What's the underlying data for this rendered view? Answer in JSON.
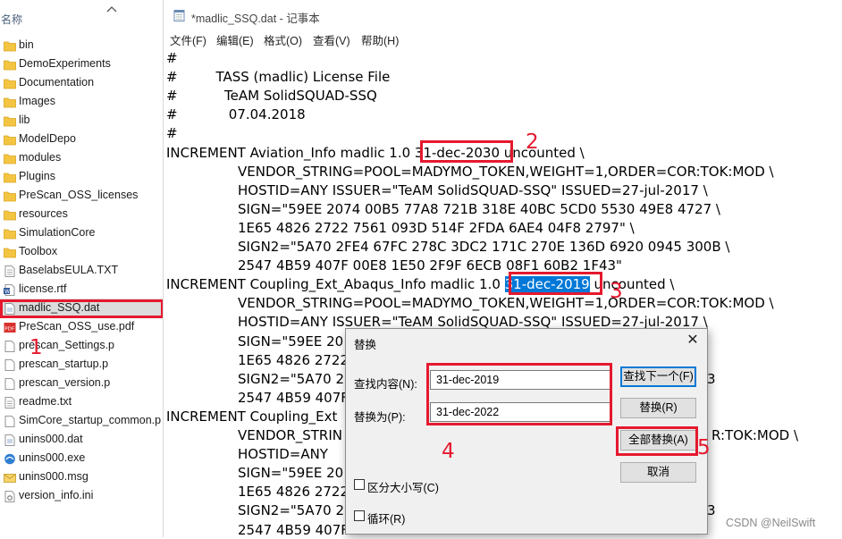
{
  "explorer": {
    "column_title": "名称",
    "files": [
      {
        "name": "bin",
        "icon": "folder-icon"
      },
      {
        "name": "DemoExperiments",
        "icon": "folder-icon"
      },
      {
        "name": "Documentation",
        "icon": "folder-icon"
      },
      {
        "name": "Images",
        "icon": "folder-icon"
      },
      {
        "name": "lib",
        "icon": "folder-icon"
      },
      {
        "name": "ModelDepo",
        "icon": "folder-icon"
      },
      {
        "name": "modules",
        "icon": "folder-icon"
      },
      {
        "name": "Plugins",
        "icon": "folder-icon"
      },
      {
        "name": "PreScan_OSS_licenses",
        "icon": "folder-icon"
      },
      {
        "name": "resources",
        "icon": "folder-icon"
      },
      {
        "name": "SimulationCore",
        "icon": "folder-icon"
      },
      {
        "name": "Toolbox",
        "icon": "folder-icon"
      },
      {
        "name": "BaselabsEULA.TXT",
        "icon": "text-file-icon"
      },
      {
        "name": "license.rtf",
        "icon": "word-document-icon"
      },
      {
        "name": "madlic_SSQ.dat",
        "icon": "data-file-icon",
        "selected": true
      },
      {
        "name": "PreScan_OSS_use.pdf",
        "icon": "pdf-icon"
      },
      {
        "name": "prescan_Settings.p",
        "icon": "blank-file-icon"
      },
      {
        "name": "prescan_startup.p",
        "icon": "blank-file-icon"
      },
      {
        "name": "prescan_version.p",
        "icon": "blank-file-icon"
      },
      {
        "name": "readme.txt",
        "icon": "text-file-icon"
      },
      {
        "name": "SimCore_startup_common.p",
        "icon": "blank-file-icon"
      },
      {
        "name": "unins000.dat",
        "icon": "data-file-icon"
      },
      {
        "name": "unins000.exe",
        "icon": "installer-icon"
      },
      {
        "name": "unins000.msg",
        "icon": "mail-file-icon"
      },
      {
        "name": "version_info.ini",
        "icon": "settings-file-icon"
      }
    ]
  },
  "notepad": {
    "title": "*madlic_SSQ.dat - 记事本",
    "menu": [
      "文件(F)",
      "编辑(E)",
      "格式(O)",
      "查看(V)",
      "帮助(H)"
    ],
    "lines": [
      {
        "text": "#",
        "indent": 0
      },
      {
        "text": "#         TASS (madlic) License File",
        "indent": 0
      },
      {
        "text": "#           TeAM SolidSQUAD-SSQ",
        "indent": 0
      },
      {
        "text": "#            07.04.2018",
        "indent": 0
      },
      {
        "text": "#",
        "indent": 0
      },
      {
        "text": "INCREMENT Aviation_Info madlic 1.0 ",
        "date": "31-dec-2030",
        "after": " uncounted \\",
        "indent": 0
      },
      {
        "text": "VENDOR_STRING=POOL=MADYMO_TOKEN,WEIGHT=1,ORDER=COR:TOK:MOD \\",
        "indent": 1
      },
      {
        "text": "HOSTID=ANY ISSUER=\"TeAM SolidSQUAD-SSQ\" ISSUED=27-jul-2017 \\",
        "indent": 1
      },
      {
        "text": "SIGN=\"59EE 2074 00B5 77A8 721B 318E 40BC 5CD0 5530 49E8 4727 \\",
        "indent": 1
      },
      {
        "text": "1E65 4826 2722 7561 093D 514F 2FDA 6AE4 04F8 2797\" \\",
        "indent": 1
      },
      {
        "text": "SIGN2=\"5A70 2FE4 67FC 278C 3DC2 171C 270E 136D 6920 0945 300B \\",
        "indent": 1
      },
      {
        "text": "2547 4B59 407F 00E8 1E50 2F9F 6ECB 08F1 60B2 1F43\"",
        "indent": 1
      },
      {
        "text": "INCREMENT Coupling_Ext_Abaqus_Info madlic 1.0 ",
        "date": "31-dec-2019",
        "after": " uncounted \\",
        "indent": 0,
        "selected": true
      },
      {
        "text": "VENDOR_STRING=POOL=MADYMO_TOKEN,WEIGHT=1,ORDER=COR:TOK:MOD \\",
        "indent": 1
      },
      {
        "text": "HOSTID=ANY ISSUER=\"TeAM SolidSQUAD-SSQ\" ISSUED=27-jul-2017 \\",
        "indent": 1
      },
      {
        "text": "SIGN=\"59EE 20",
        "indent": 1
      },
      {
        "text": "1E65 4826 2722",
        "indent": 1
      },
      {
        "text": "SIGN2=\"5A70 2",
        "right": "3",
        "indent": 1
      },
      {
        "text": "2547 4B59 407F",
        "indent": 1
      },
      {
        "text": "INCREMENT Coupling_Ext",
        "indent": 0
      },
      {
        "text": "VENDOR_STRIN",
        "right": "R:TOK:MOD \\",
        "indent": 1
      },
      {
        "text": "HOSTID=ANY",
        "indent": 1
      },
      {
        "text": "SIGN=\"59EE 20",
        "indent": 1
      },
      {
        "text": "1E65 4826 2722",
        "indent": 1
      },
      {
        "text": "SIGN2=\"5A70 2",
        "right": "3",
        "indent": 1
      },
      {
        "text": "2547 4B59 407F",
        "indent": 1
      }
    ]
  },
  "annotations": {
    "n1": "1",
    "n2": "2",
    "n3": "3",
    "n4": "4",
    "n5": "5"
  },
  "dialog": {
    "title": "替换",
    "find_label": "查找内容(N):",
    "find_value": "31-dec-2019",
    "replace_label": "替换为(P):",
    "replace_value": "31-dec-2022",
    "buttons": {
      "find_next": "查找下一个(F)",
      "replace": "替换(R)",
      "replace_all": "全部替换(A)",
      "cancel": "取消"
    },
    "match_case": "区分大小写(C)",
    "wrap": "循环(R)"
  },
  "watermark": "CSDN @NeilSwift",
  "colors": {
    "annotation_red": "#e5192e",
    "selection_blue": "#0078d7",
    "folder_yellow": "#f4c542"
  }
}
